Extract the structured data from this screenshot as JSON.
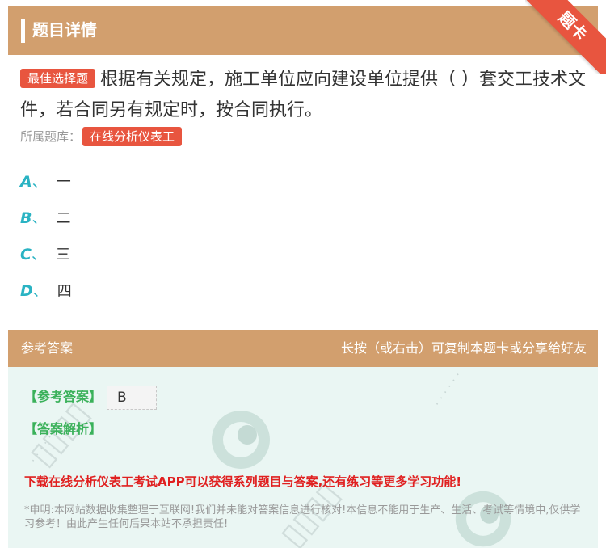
{
  "header": {
    "title": "题目详情",
    "corner_ribbon": "题卡"
  },
  "question": {
    "tag": "最佳选择题",
    "text": "根据有关规定，施工单位应向建设单位提供（ ）套交工技术文件，若合同另有规定时，按合同执行。"
  },
  "bank": {
    "label": "所属题库：",
    "name": "在线分析仪表工"
  },
  "options": [
    {
      "letter": "A",
      "text": "一"
    },
    {
      "letter": "B",
      "text": "二"
    },
    {
      "letter": "C",
      "text": "三"
    },
    {
      "letter": "D",
      "text": "四"
    }
  ],
  "answer_bar": {
    "left": "参考答案",
    "right": "长按（或右击）可复制本题卡或分享给好友"
  },
  "answer": {
    "ref_label": "【参考答案】",
    "ref_value": "B",
    "analysis_label": "【答案解析】",
    "promo": "下载在线分析仪表工考试APP可以获得系列题目与答案,还有练习等更多学习功能!",
    "notice": "*申明:本网站数据收集整理于互联网!我们并未能对答案信息进行核对!本信息不能用于生产、生活、考试等情境中,仅供学习参考！由此产生任何后果本站不承担责任!"
  },
  "colors": {
    "header_bg": "#d29f6e",
    "accent_red": "#e8553f",
    "option_letter": "#2ab3c3",
    "answer_green": "#3ab15a",
    "panel_bg": "#eaf6f3"
  }
}
